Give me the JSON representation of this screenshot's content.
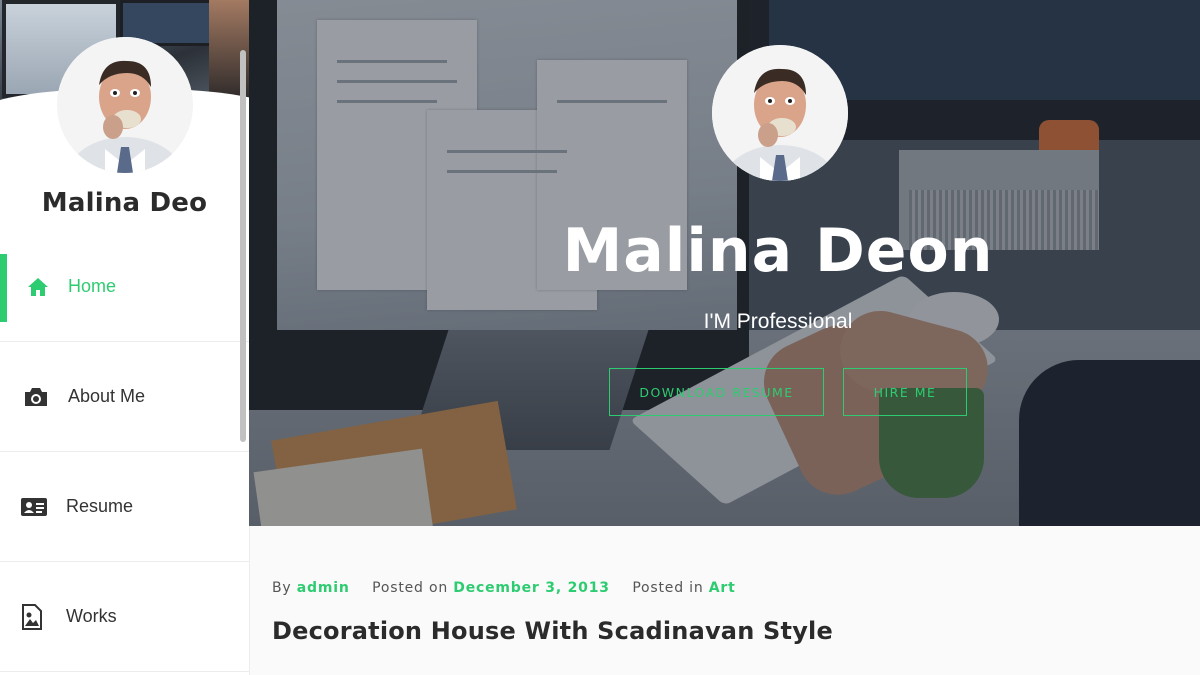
{
  "sidebar": {
    "name": "Malina Deo",
    "menu": [
      {
        "label": "Home",
        "icon": "home-icon",
        "active": true
      },
      {
        "label": "About Me",
        "icon": "camera-icon",
        "active": false
      },
      {
        "label": "Resume",
        "icon": "id-card-icon",
        "active": false
      },
      {
        "label": "Works",
        "icon": "image-file-icon",
        "active": false
      }
    ]
  },
  "hero": {
    "name": "Malina Deon",
    "subtitle": "I'M Professional",
    "download_label": "DOWNLOAD RESUME",
    "hire_label": "HIRE ME"
  },
  "post": {
    "by_label": "By",
    "author": "admin",
    "posted_on_label": "Posted on",
    "date": "December 3, 2013",
    "posted_in_label": "Posted in",
    "category": "Art",
    "title": "Decoration House With Scadinavan Style"
  },
  "colors": {
    "accent": "#2ecc71",
    "text": "#2b2b2b"
  }
}
